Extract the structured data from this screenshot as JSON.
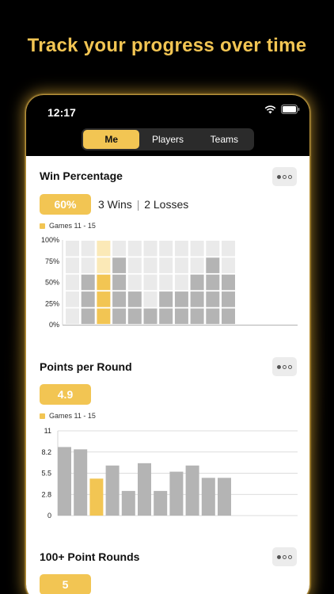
{
  "headline": "Track your progress over time",
  "status_bar": {
    "time": "12:17"
  },
  "tabs": [
    {
      "label": "Me",
      "active": true
    },
    {
      "label": "Players",
      "active": false
    },
    {
      "label": "Teams",
      "active": false
    }
  ],
  "colors": {
    "accent": "#F2C553",
    "bar_grey": "#B4B4B4",
    "bar_light": "#EAEAEA",
    "highlight_light": "#FBE9B7"
  },
  "win_percentage": {
    "title": "Win Percentage",
    "pill": "60%",
    "wins": "3 Wins",
    "separator": "|",
    "losses": "2 Losses",
    "legend": "Games 11 - 15"
  },
  "points_per_round": {
    "title": "Points per Round",
    "pill": "4.9",
    "legend": "Games 11 - 15"
  },
  "hundred_point_rounds": {
    "title": "100+ Point Rounds",
    "pill": "5"
  },
  "chart_data": [
    {
      "type": "bar",
      "title": "Win Percentage",
      "y_ticks": [
        "100%",
        "75%",
        "50%",
        "25%",
        "0%"
      ],
      "ylim": [
        0,
        100
      ],
      "values": [
        0,
        60,
        60,
        80,
        40,
        20,
        40,
        40,
        60,
        80,
        60
      ],
      "highlight_index": 2,
      "grid": true
    },
    {
      "type": "bar",
      "title": "Points per Round",
      "y_ticks": [
        "11",
        "8.2",
        "5.5",
        "2.8",
        "0"
      ],
      "ylim": [
        0,
        11
      ],
      "values": [
        8.9,
        8.6,
        4.8,
        6.5,
        3.2,
        6.8,
        3.2,
        5.7,
        6.5,
        4.9,
        4.9
      ],
      "highlight_index": 2,
      "grid": true
    }
  ]
}
